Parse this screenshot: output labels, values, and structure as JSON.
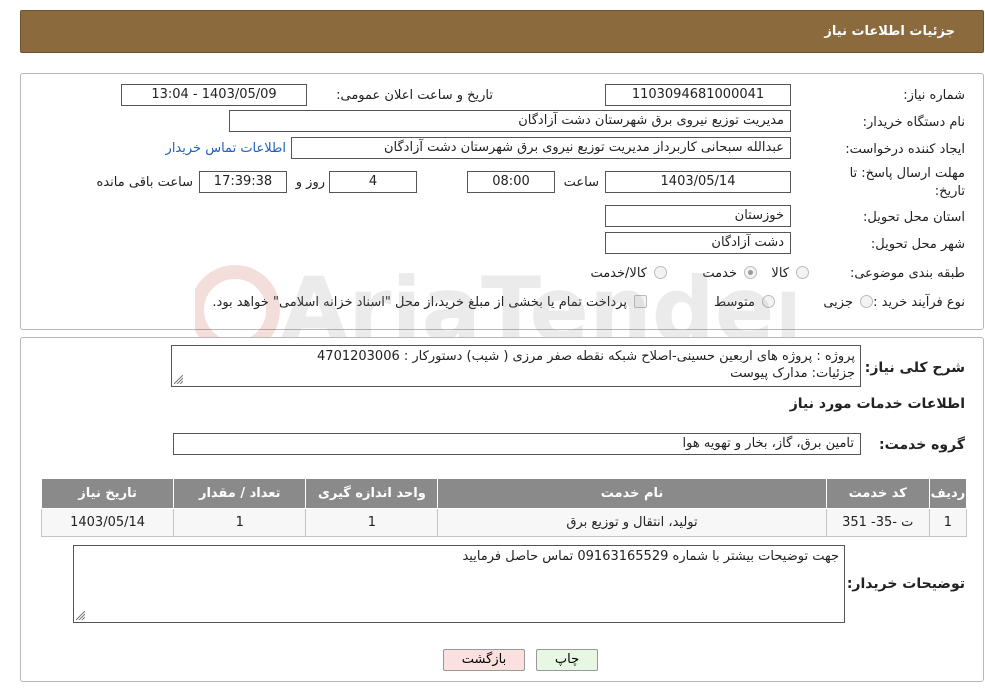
{
  "header": {
    "title": "جزئیات اطلاعات نیاز"
  },
  "form": {
    "need_number": {
      "label": "شماره نیاز:",
      "value": "1103094681000041"
    },
    "announce_datetime": {
      "label": "تاریخ و ساعت اعلان عمومی:",
      "value": "1403/05/09 - 13:04"
    },
    "buyer_org": {
      "label": "نام دستگاه خریدار:",
      "value": "مدیریت توزیع نیروی برق شهرستان دشت آزادگان"
    },
    "requester": {
      "label": "ایجاد کننده درخواست:",
      "value": "عبدالله سبحانی کاربرداز مدیریت توزیع نیروی برق شهرستان دشت آزادگان"
    },
    "buyer_contact_link": "اطلاعات تماس خریدار",
    "deadline": {
      "label_line1": "مهلت ارسال پاسخ: تا",
      "label_line2": "تاریخ:",
      "date": "1403/05/14",
      "time_label": "ساعت",
      "time": "08:00",
      "days": "4",
      "days_label": "روز و",
      "remaining": "17:39:38",
      "remaining_label": "ساعت باقی مانده"
    },
    "province": {
      "label": "استان محل تحویل:",
      "value": "خوزستان"
    },
    "city": {
      "label": "شهر محل تحویل:",
      "value": "دشت آزادگان"
    },
    "category": {
      "label": "طبقه بندی موضوعی:",
      "options": [
        {
          "label": "کالا",
          "checked": false
        },
        {
          "label": "خدمت",
          "checked": true
        },
        {
          "label": "کالا/خدمت",
          "checked": false
        }
      ]
    },
    "purchase_process": {
      "label": "نوع فرآیند خرید :",
      "options": [
        {
          "label": "جزیی",
          "checked": false
        },
        {
          "label": "متوسط",
          "checked": false
        }
      ],
      "payment_note": "پرداخت تمام یا بخشی از مبلغ خرید،از محل \"اسناد خزانه اسلامی\" خواهد بود."
    }
  },
  "details": {
    "summary_label": "شرح کلی نیاز:",
    "summary_line1": "پروژه :  پروژه های اربعین حسینی-اصلاح شبکه نقطه صفر مرزی ( شیب) دستورکار : 4701203006",
    "summary_line2": "جزئیات: مدارک پیوست",
    "services_heading": "اطلاعات خدمات مورد نیاز",
    "service_group_label": "گروه خدمت:",
    "service_group_value": "تامین برق، گاز، بخار و تهویه هوا",
    "table": {
      "headers": [
        "ردیف",
        "کد خدمت",
        "نام خدمت",
        "واحد اندازه گیری",
        "تعداد / مقدار",
        "تاریخ نیاز"
      ],
      "rows": [
        [
          "1",
          "ت -35- 351",
          "تولید، انتقال و توزیع برق",
          "1",
          "1",
          "1403/05/14"
        ]
      ]
    },
    "buyer_notes_label": "توضیحات خریدار:",
    "buyer_notes_value": "جهت توضیحات بیشتر با شماره 09163165529 تماس حاصل فرمایید"
  },
  "buttons": {
    "print": "چاپ",
    "back": "بازگشت"
  },
  "watermark": {
    "text": "AriaTender.neT"
  },
  "colors": {
    "header_bg": "#8b6a3e",
    "table_header_bg": "#8a8a8a",
    "link": "#1f5fbf",
    "print_btn": "#e7f7e4",
    "back_btn": "#fbe0e0"
  }
}
